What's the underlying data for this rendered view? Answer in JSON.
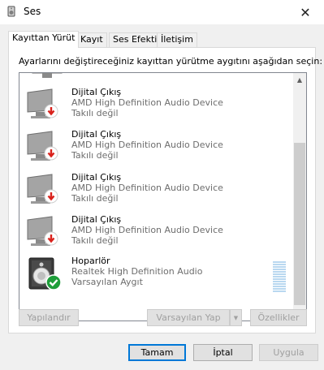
{
  "window": {
    "title": "Ses",
    "close_glyph": "✕"
  },
  "tabs": [
    {
      "label": "Kayıttan Yürüt",
      "active": true
    },
    {
      "label": "Kayıt",
      "active": false
    },
    {
      "label": "Ses Efekti",
      "active": false
    },
    {
      "label": "İletişim",
      "active": false
    }
  ],
  "instruction": "Ayarlarını değiştireceğiniz kayıttan yürütme aygıtını aşağıdan seçin:",
  "devices": [
    {
      "name": "Dijital Çıkış",
      "description": "AMD High Definition Audio Device",
      "status": "Takılı değil",
      "icon": "monitor-icon",
      "badge": "disconnected-badge-icon"
    },
    {
      "name": "Dijital Çıkış",
      "description": "AMD High Definition Audio Device",
      "status": "Takılı değil",
      "icon": "monitor-icon",
      "badge": "disconnected-badge-icon"
    },
    {
      "name": "Dijital Çıkış",
      "description": "AMD High Definition Audio Device",
      "status": "Takılı değil",
      "icon": "monitor-icon",
      "badge": "disconnected-badge-icon"
    },
    {
      "name": "Dijital Çıkış",
      "description": "AMD High Definition Audio Device",
      "status": "Takılı değil",
      "icon": "monitor-icon",
      "badge": "disconnected-badge-icon"
    },
    {
      "name": "Hoparlör",
      "description": "Realtek High Definition Audio",
      "status": "Varsayılan Aygıt",
      "icon": "speaker-icon",
      "badge": "default-check-badge-icon"
    }
  ],
  "buttons": {
    "configure": "Yapılandır",
    "set_default": "Varsayılan Yap",
    "properties": "Özellikler",
    "ok": "Tamam",
    "cancel": "İptal",
    "apply": "Uygula"
  },
  "colors": {
    "accent": "#0078d7",
    "error_badge": "#d9221c",
    "ok_badge": "#1e9e3a"
  }
}
